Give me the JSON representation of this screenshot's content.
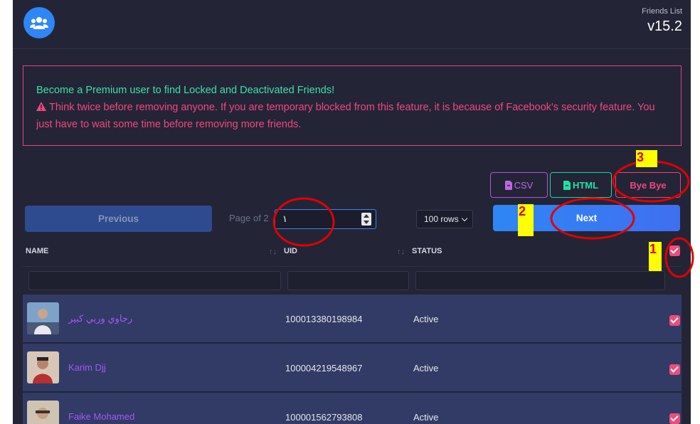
{
  "header": {
    "app_title": "Friends List",
    "version": "v15.2",
    "logo_icon": "users-group-icon",
    "logo_color": "#2f86f5"
  },
  "alert": {
    "premium_text": "Become a Premium user to find Locked and Deactivated Friends!",
    "warning_text": "Think twice before removing anyone. If you are temporary blocked from this feature, it is because of Facebook's security feature. You just have to wait some time before removing more friends.",
    "warning_icon": "warning-triangle-icon",
    "border_color": "#e6427d"
  },
  "export": {
    "csv_label": "CSV",
    "html_label": "HTML",
    "bye_label": "Bye Bye"
  },
  "pagination": {
    "previous_label": "Previous",
    "page_of_label": "Page of 2",
    "page_value": "١",
    "rows_selected": "100 rows",
    "next_label": "Next"
  },
  "table": {
    "columns": [
      "NAME",
      "UID",
      "STATUS"
    ],
    "rows": [
      {
        "name": "رجاوي وربي كبير",
        "uid": "100013380198984",
        "status": "Active",
        "checked": true
      },
      {
        "name": "Karim Djj",
        "uid": "100004219548967",
        "status": "Active",
        "checked": true
      },
      {
        "name": "Faike Mohamed",
        "uid": "100001562793808",
        "status": "Active",
        "checked": true
      }
    ]
  },
  "annotations": {
    "labels": [
      "1",
      "2",
      "3"
    ],
    "circle_color": "#e00000",
    "label_bg": "#ffff00"
  }
}
